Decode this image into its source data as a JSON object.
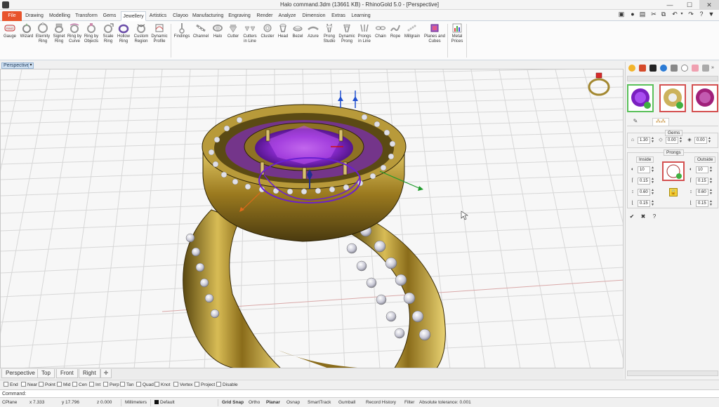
{
  "window": {
    "title": "Halo command.3dm (13661 KB) - RhinoGold 5.0 - [Perspective]",
    "minimize": "—",
    "maximize": "☐",
    "close": "✕"
  },
  "ribbon_tabs": [
    "File",
    "Drawing",
    "Modelling",
    "Transform",
    "Gems",
    "Jewellery",
    "Artistics",
    "Clayoo",
    "Manufacturing",
    "Engraving",
    "Render",
    "Analyze",
    "Dimension",
    "Extras",
    "Learning"
  ],
  "active_tab": "Jewellery",
  "tools": [
    {
      "label": "Gauge"
    },
    {
      "label": "Wizard"
    },
    {
      "label": "Eternity\nRing"
    },
    {
      "label": "Signet\nRing"
    },
    {
      "label": "Ring by\nCurve"
    },
    {
      "label": "Ring by\nObjects"
    },
    {
      "label": "Scale\nRing"
    },
    {
      "label": "Hollow\nRing"
    },
    {
      "label": "Custom\nRegion"
    },
    {
      "label": "Dynamic\nProfile"
    },
    {
      "label": "Findings"
    },
    {
      "label": "Channel"
    },
    {
      "label": "Halo"
    },
    {
      "label": "Cutter"
    },
    {
      "label": "Cutters\nin Line"
    },
    {
      "label": "Cluster"
    },
    {
      "label": "Head"
    },
    {
      "label": "Bezel"
    },
    {
      "label": "Azure"
    },
    {
      "label": "Prong\nStudio"
    },
    {
      "label": "Dynamic\nProng"
    },
    {
      "label": "Prongs\nin Line"
    },
    {
      "label": "Chain"
    },
    {
      "label": "Rope"
    },
    {
      "label": "Millgrain"
    },
    {
      "label": "Planes and\nCubes"
    },
    {
      "label": "Metal\nPrices"
    }
  ],
  "viewport": {
    "name": "Perspective",
    "dropdown": "▾"
  },
  "viewport_tabs": [
    "Perspective",
    "Top",
    "Front",
    "Right"
  ],
  "viewport_add": "✚",
  "panel": {
    "groups": {
      "gems": "Gems",
      "prongs": "Prongs",
      "inside": "Inside",
      "outside": "Outside"
    },
    "gems_fields": [
      "1.30",
      "0.00",
      "0.00"
    ],
    "inside_fields": [
      "10",
      "0.15",
      "0.60",
      "0.15"
    ],
    "outside_fields": [
      "10",
      "0.15",
      "0.60",
      "0.15"
    ]
  },
  "osnaps": [
    "End",
    "Near",
    "Point",
    "Mid",
    "Cen",
    "Int",
    "Perp",
    "Tan",
    "Quad",
    "Knot",
    "Vertex",
    "Project",
    "Disable"
  ],
  "command": {
    "label": "Command:",
    "value": ""
  },
  "status": {
    "cplane": "CPlane",
    "x": "x 7.333",
    "y": "y 17.796",
    "z": "z 0.000",
    "units": "Millimeters",
    "layer": "Default",
    "grid_snap": "Grid Snap",
    "ortho": "Ortho",
    "planar": "Planar",
    "osnap": "Osnap",
    "smarttrack": "SmartTrack",
    "gumball": "Gumball",
    "record_history": "Record History",
    "filter": "Filter",
    "tolerance": "Absolute tolerance: 0.001"
  },
  "colors": {
    "file_tab": "#e8542c",
    "gold": "#b8962e",
    "amethyst": "#7a2bb8",
    "grid": "#dadada"
  }
}
